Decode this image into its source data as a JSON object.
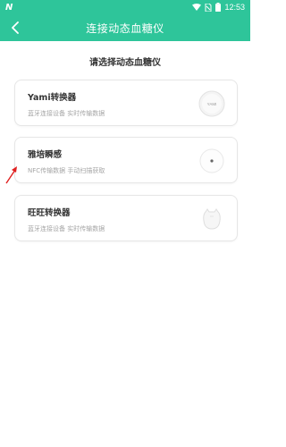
{
  "status_bar": {
    "logo": "N",
    "time": "12:53"
  },
  "nav": {
    "title": "连接动态血糖仪"
  },
  "section": {
    "title": "请选择动态血糖仪"
  },
  "devices": [
    {
      "name": "Yami转换器",
      "desc": "蓝牙连接设备 实时传输数据",
      "image_label": "YAMI"
    },
    {
      "name": "雅培瞬感",
      "desc": "NFC传输数据 手动扫描获取"
    },
    {
      "name": "旺旺转换器",
      "desc": "蓝牙连接设备 实时传输数据"
    }
  ],
  "colors": {
    "brand": "#2ec59a",
    "annotation_arrow": "#e02020"
  }
}
